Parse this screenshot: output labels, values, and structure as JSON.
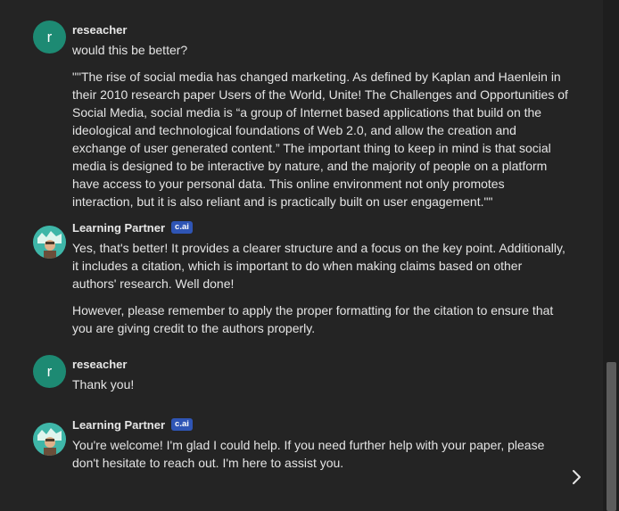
{
  "messages": [
    {
      "sender": "reseacher",
      "avatar_letter": "r",
      "paragraphs": [
        "would this be better?",
        "\"\"The rise of social media has changed marketing. As defined by Kaplan and Haenlein in their 2010 research paper Users of the World, Unite! The Challenges and Opportunities of Social Media, social media is “a group of Internet based applications that build on the ideological and technological foundations of Web 2.0, and allow the creation and exchange of user generated content.” The important thing to keep in mind is that social media is designed to be interactive by nature, and the majority of people on a platform have access to your personal data. This online environment not only promotes interaction, but it is also reliant and is practically built on user engagement.\"\""
      ]
    },
    {
      "sender": "Learning Partner",
      "badge": "c.ai",
      "paragraphs": [
        "Yes, that's better! It provides a clearer structure and a focus on the key point. Additionally, it includes a citation, which is important to do when making claims based on other authors' research. Well done!",
        "However, please remember to apply the proper formatting for the citation to ensure that you are giving credit to the authors properly."
      ]
    },
    {
      "sender": "reseacher",
      "avatar_letter": "r",
      "paragraphs": [
        "Thank you!"
      ]
    },
    {
      "sender": "Learning Partner",
      "badge": "c.ai",
      "paragraphs": [
        "You're welcome! I'm glad I could help. If you need further help with your paper, please don't hesitate to reach out. I'm here to assist you."
      ]
    }
  ],
  "icons": {
    "next": "chevron-right-icon",
    "bot_avatar": "learning-partner-avatar-icon"
  },
  "colors": {
    "background": "#242424",
    "user_avatar": "#1d8a73",
    "badge": "#2f55b5"
  }
}
